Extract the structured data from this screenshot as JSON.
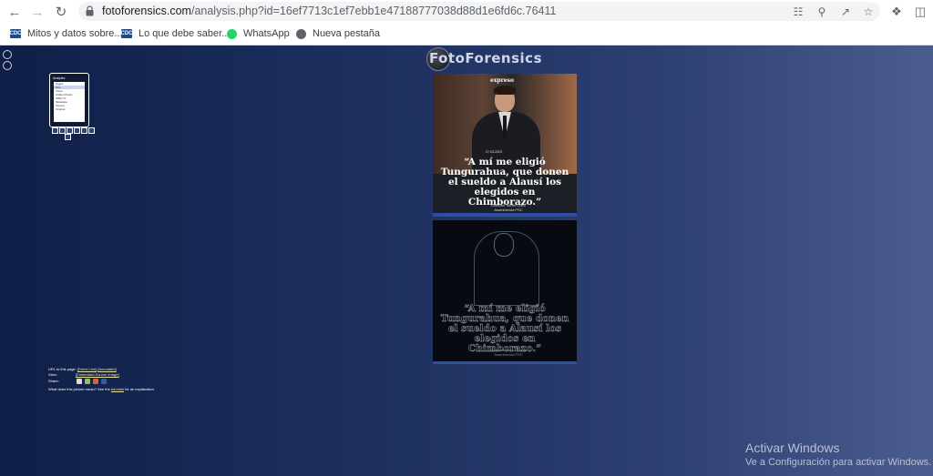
{
  "browser": {
    "url_host": "fotoforensics.com",
    "url_path": "/analysis.php?id=16ef7713c1ef7ebb1e47188777038d88d1e6fd6c.76411",
    "bookmarks": [
      {
        "label": "Mitos y datos sobre...",
        "icon": "cdc-icon",
        "color": "#1a4a8c"
      },
      {
        "label": "Lo que debe saber...",
        "icon": "cdc-icon",
        "color": "#1a4a8c"
      },
      {
        "label": "WhatsApp",
        "icon": "whatsapp-icon",
        "color": "#25d366"
      },
      {
        "label": "Nueva pestaña",
        "icon": "globe-icon",
        "color": "#5f6368"
      }
    ]
  },
  "page": {
    "logo_text": "FotoForensics",
    "thumb_title": "Analysis:",
    "thumb_options": [
      "Digest",
      "ELA",
      "Clone",
      "Hidden Pixels",
      "JPEG %",
      "Metadata",
      "Source",
      "Original"
    ],
    "photo": {
      "brand": "expreso",
      "date": "27-03-2023",
      "quote": "“A mí me eligió Tungurahua, que donen el sueldo a Alausí los elegidos en Chimborazo.”",
      "attribution_name": "Esteban Torres Cobo",
      "attribution_role": "Asambleísta PSC"
    },
    "info": {
      "url_label": "URL to this page:",
      "url_links": [
        "[Direct Link]",
        "[Annotated]"
      ],
      "view_label": "View:",
      "view_link": "[Embedded Source Image]",
      "share_label": "Share:",
      "explain_text": "What does this picture mean? See the",
      "explain_link": "tutorials",
      "explain_tail": "for an explanation."
    }
  },
  "os": {
    "activate_title": "Activar Windows",
    "activate_sub": "Ve a Configuración para activar Windows."
  }
}
